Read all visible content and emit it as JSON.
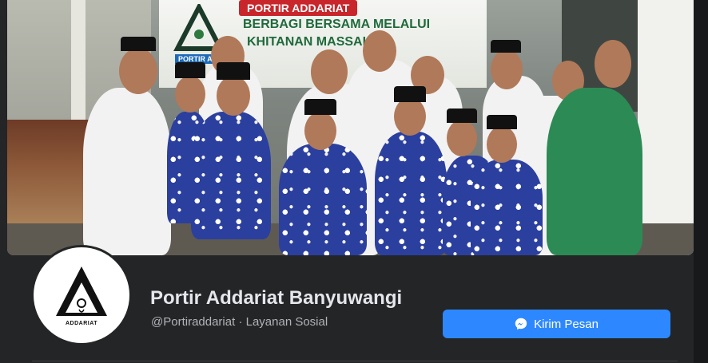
{
  "cover": {
    "banner_title": "PORTIR ADDARIAT",
    "banner_line1": "BERBAGI BERSAMA MELALUI",
    "banner_line2": "KHITANAN MASSAL",
    "banner_tag": "PORTIR AD"
  },
  "profile": {
    "logo_text": "ADDARIAT",
    "name": "Portir Addariat Banyuwangi",
    "meta": "@Portiraddariat · Layanan Sosial"
  },
  "actions": {
    "message_label": "Kirim Pesan",
    "message_icon": "messenger-icon"
  },
  "colors": {
    "background": "#242526",
    "button": "#2d88ff",
    "title_text": "#e4e6eb",
    "meta_text": "#b0b3b8"
  }
}
